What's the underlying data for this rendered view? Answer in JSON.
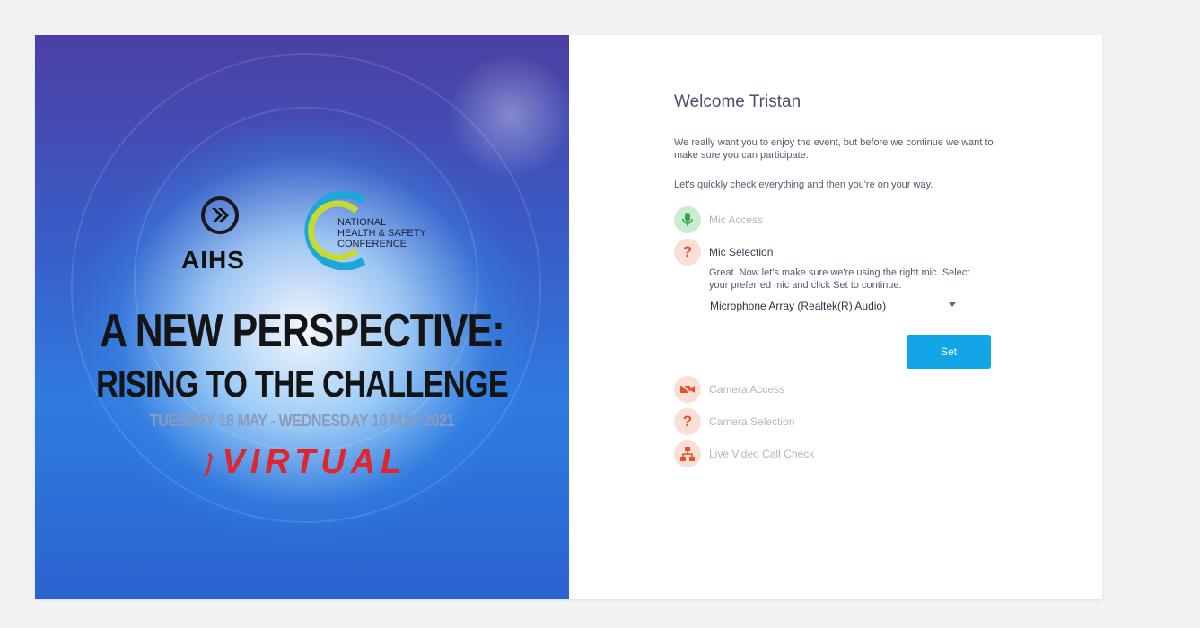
{
  "hero": {
    "logo_left_text": "AIHS",
    "logo_right_lines": [
      "NATIONAL",
      "HEALTH & SAFETY",
      "CONFERENCE"
    ],
    "headline_1": "A NEW PERSPECTIVE:",
    "headline_2": "RISING TO THE CHALLENGE",
    "dates": "TUESDAY 18 MAY - WEDNESDAY 19 MAY 2021",
    "virtual": "VIRTUAL"
  },
  "panel": {
    "welcome": "Welcome Tristan",
    "intro": "We really want you to enjoy the event, but before we continue we want to make sure you can participate.",
    "intro2": "Let's quickly check everything and then you're on your way.",
    "steps": [
      {
        "label": "Mic Access",
        "icon": "mic-icon",
        "status": "done"
      },
      {
        "label": "Mic Selection",
        "icon": "question-icon",
        "status": "active"
      },
      {
        "label": "Camera Access",
        "icon": "camera-off-icon",
        "status": "pending"
      },
      {
        "label": "Camera Selection",
        "icon": "question-icon",
        "status": "pending"
      },
      {
        "label": "Live Video Call Check",
        "icon": "network-icon",
        "status": "pending"
      }
    ],
    "mic_desc": "Great. Now let's make sure we're using the right mic. Select your preferred mic and click Set to continue.",
    "mic_select_value": "Microphone Array (Realtek(R) Audio)",
    "set_label": "Set"
  },
  "colors": {
    "accent": "#12a6e6",
    "success": "#33a852",
    "warning": "#e8502b",
    "page_bg": "#f0f2f4"
  }
}
